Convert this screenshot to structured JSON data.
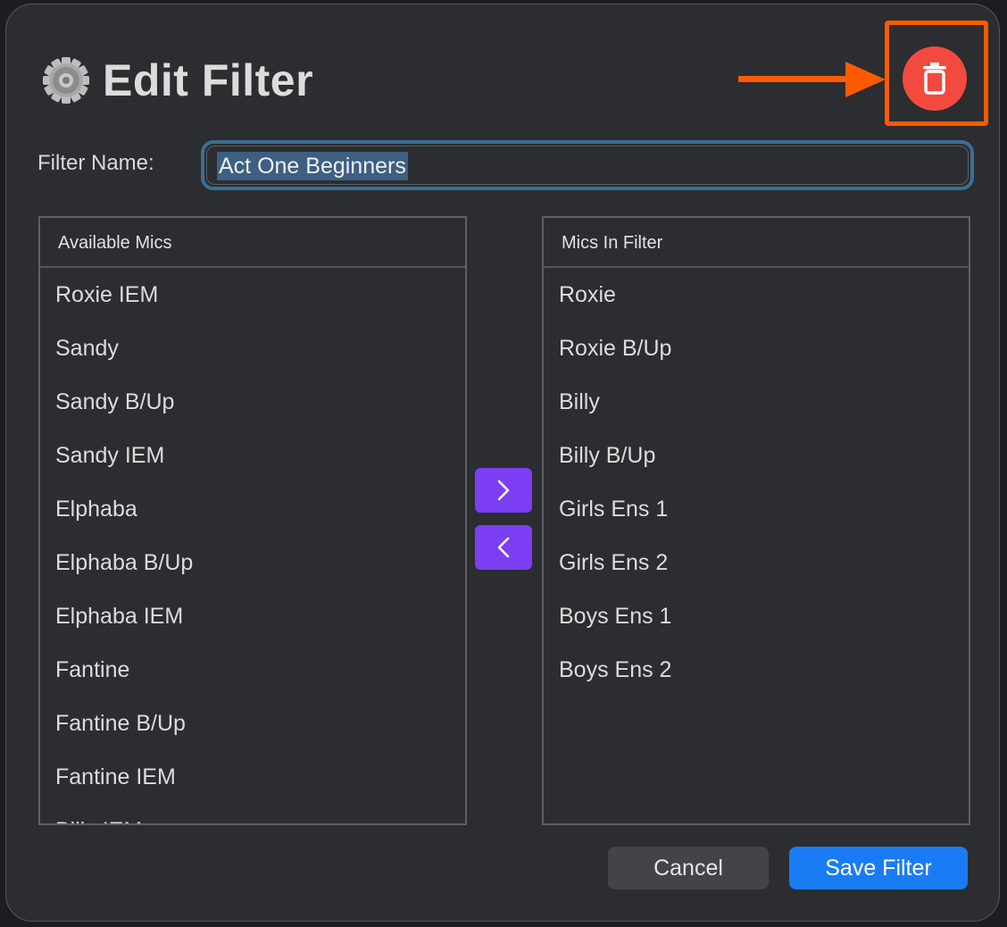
{
  "dialog": {
    "title": "Edit Filter",
    "title_icon": "gear-icon",
    "delete_icon": "trash-icon",
    "annotation": {
      "arrow_color": "#ff5a00",
      "highlight_color": "#ff5a00"
    }
  },
  "filter_name": {
    "label": "Filter Name:",
    "value": "Act One Beginners"
  },
  "available_mics": {
    "header": "Available Mics",
    "items": [
      "Roxie IEM",
      "Sandy",
      "Sandy B/Up",
      "Sandy IEM",
      "Elphaba",
      "Elphaba B/Up",
      "Elphaba IEM",
      "Fantine",
      "Fantine B/Up",
      "Fantine IEM",
      "Billy IEM"
    ]
  },
  "mics_in_filter": {
    "header": "Mics In Filter",
    "items": [
      "Roxie",
      "Roxie B/Up",
      "Billy",
      "Billy B/Up",
      "Girls Ens 1",
      "Girls Ens 2",
      "Boys Ens 1",
      "Boys Ens 2"
    ]
  },
  "move_buttons": {
    "add_icon": "chevron-right-icon",
    "remove_icon": "chevron-left-icon",
    "color": "#7b3ef2"
  },
  "footer": {
    "cancel_label": "Cancel",
    "save_label": "Save Filter",
    "save_color": "#1a7cf5"
  }
}
